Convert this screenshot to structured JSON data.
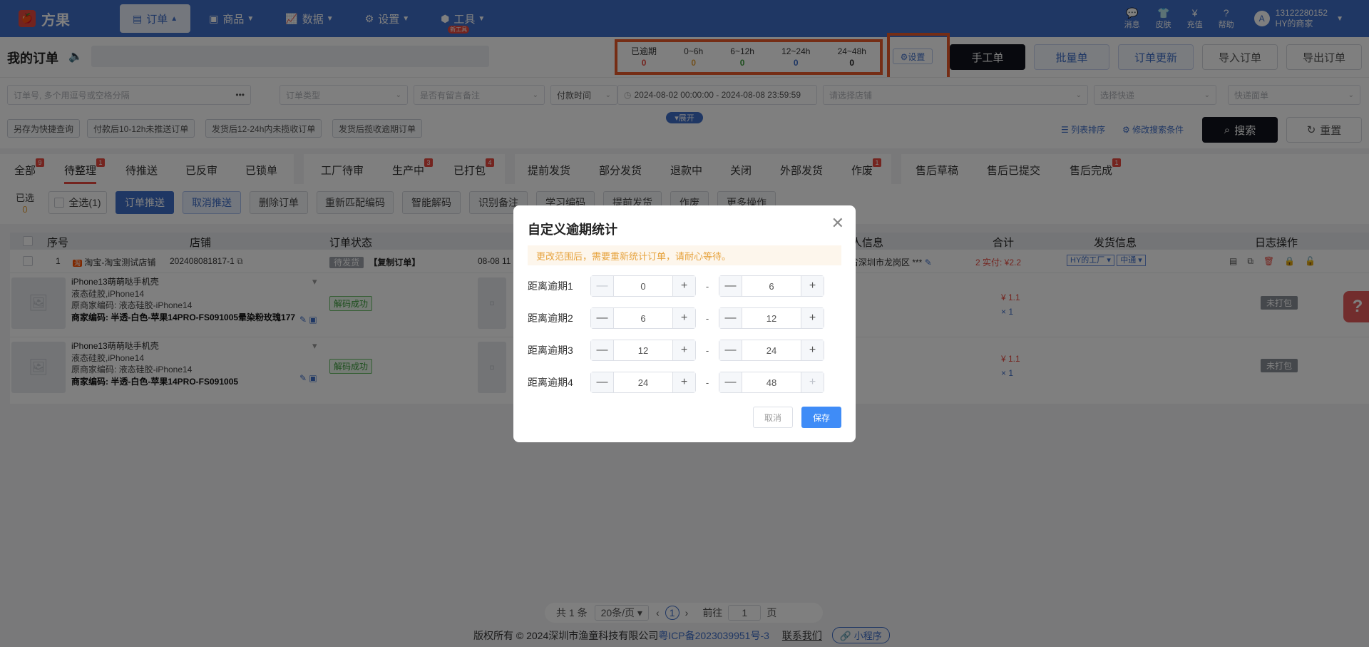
{
  "app": {
    "logo_glyph": "🍎",
    "name": "方果"
  },
  "nav": {
    "items": [
      {
        "label": "订单",
        "icon": "clipboard-icon",
        "glyph": "▤",
        "active": true,
        "caret": "▲"
      },
      {
        "label": "商品",
        "icon": "shop-icon",
        "glyph": "▣",
        "active": false,
        "caret": "▼"
      },
      {
        "label": "数据",
        "icon": "chart-icon",
        "glyph": "📈",
        "active": false,
        "caret": "▼"
      },
      {
        "label": "设置",
        "icon": "gear-icon",
        "glyph": "⚙",
        "active": false,
        "caret": "▼"
      },
      {
        "label": "工具",
        "icon": "box-icon",
        "glyph": "⬢",
        "active": false,
        "caret": "▼",
        "badge": "新工具"
      }
    ],
    "utils": [
      {
        "label": "消息",
        "glyph": "💬"
      },
      {
        "label": "皮肤",
        "glyph": "👕"
      },
      {
        "label": "充值",
        "glyph": "¥"
      },
      {
        "label": "帮助",
        "glyph": "?"
      }
    ],
    "user": {
      "avatar": "A",
      "phone": "13122280152",
      "shop": "HY的商家",
      "caret": "▼"
    }
  },
  "header": {
    "title": "我的订单",
    "speaker": "🔈",
    "overdue": [
      {
        "label": "已逾期",
        "value": "0",
        "color": "#e8493f"
      },
      {
        "label": "0~6h",
        "value": "0",
        "color": "#e6a23c"
      },
      {
        "label": "6~12h",
        "value": "0",
        "color": "#3a9d3a"
      },
      {
        "label": "12~24h",
        "value": "0",
        "color": "#3f6ec9"
      },
      {
        "label": "24~48h",
        "value": "0",
        "color": "#222222"
      }
    ],
    "settings_btn": "⚙设置",
    "buttons": {
      "manual": "手工单",
      "batch": "批量单",
      "update": "订单更新",
      "import": "导入订单",
      "export": "导出订单"
    }
  },
  "filters": {
    "order_no_placeholder": "订单号, 多个用逗号或空格分隔",
    "more": "•••",
    "order_type": "订单类型",
    "has_note": "是否有留言备注",
    "time_type": "付款时间",
    "date_range": "2024-08-02 00:00:00  -  2024-08-08 23:59:59",
    "shop": "请选择店铺",
    "express": "选择快递",
    "waybill": "快递面单",
    "quick": [
      "另存为快捷查询",
      "付款后10-12h未推送订单",
      "发货后12-24h内未揽收订单",
      "发货后揽收逾期订单"
    ],
    "expand": "▾展开",
    "sort_link": "列表排序",
    "edit_link": "修改搜索条件",
    "search": "搜索",
    "reset": "重置"
  },
  "tabs": [
    {
      "label": "全部",
      "badge": "9"
    },
    {
      "label": "待整理",
      "badge": "1",
      "active": true
    },
    {
      "label": "待推送"
    },
    {
      "label": "已反审"
    },
    {
      "label": "已锁单"
    },
    {
      "label": "工厂待审"
    },
    {
      "label": "生产中",
      "badge": "3"
    },
    {
      "label": "已打包",
      "badge": "4"
    },
    {
      "label": "提前发货"
    },
    {
      "label": "部分发货"
    },
    {
      "label": "退款中"
    },
    {
      "label": "关闭"
    },
    {
      "label": "外部发货"
    },
    {
      "label": "作废",
      "badge": "1"
    },
    {
      "label": "售后草稿"
    },
    {
      "label": "售后已提交"
    },
    {
      "label": "售后完成",
      "badge": "1"
    }
  ],
  "actions": {
    "selected_label": "已选",
    "selected_count": "0",
    "select_all": "全选(1)",
    "push": "订单推送",
    "cancel_push": "取消推送",
    "delete": "删除订单",
    "rematch": "重新匹配编码",
    "smart_decode": "智能解码",
    "identify_note": "识别备注",
    "learn_code": "学习编码",
    "early_ship": "提前发货",
    "void": "作废",
    "more": "更多操作"
  },
  "table": {
    "headers": {
      "no": "序号",
      "shop": "店铺",
      "status": "订单状态",
      "receiver": "人信息",
      "total": "合计",
      "ship": "发货信息",
      "log": "日志操作"
    },
    "order": {
      "index": "1",
      "shop": "淘宝-淘宝测试店铺",
      "order_no": "202408081817-1",
      "status": "待发货",
      "copy_tag": "【复制订单】",
      "time": "08-08 11",
      "address": "省深圳市龙岗区 ***",
      "total": "2 实付: ¥2.2",
      "factory": "HY的工厂 ▾",
      "express": "中通 ▾"
    },
    "items": [
      {
        "title": "iPhone13萌萌哒手机壳",
        "sub": "液态硅胶,iPhone14",
        "orig": "原商家编码: 液态硅胶-iPhone14",
        "code": "商家编码: 半透-白色-苹果14PRO-FS091005晕染粉玫瑰177",
        "decode": "解码成功",
        "price": "¥ 1.1",
        "qty": "× 1",
        "pack": "未打包"
      },
      {
        "title": "iPhone13萌萌哒手机壳",
        "sub": "液态硅胶,iPhone14",
        "orig": "原商家编码: 液态硅胶-iPhone14",
        "code": "商家编码: 半透-白色-苹果14PRO-FS091005",
        "decode": "解码成功",
        "price": "¥ 1.1",
        "qty": "× 1",
        "pack": "未打包"
      }
    ]
  },
  "pager": {
    "total": "共 1 条",
    "per_page": "20条/页 ▾",
    "prev": "‹",
    "page": "1",
    "next": "›",
    "goto": "前往",
    "goto_val": "1",
    "page_unit": "页"
  },
  "footer": {
    "copyright": "版权所有 © 2024深圳市渔童科技有限公司",
    "icp": "粤ICP备2023039951号-3",
    "contact": "联系我们",
    "mini": "🔗 小程序"
  },
  "help_float": "?",
  "modal": {
    "title": "自定义逾期统计",
    "close": "✕",
    "notice": "更改范围后，需要重新统计订单，请耐心等待。",
    "rows": [
      {
        "label": "距离逾期1",
        "from": "0",
        "to": "6"
      },
      {
        "label": "距离逾期2",
        "from": "6",
        "to": "12"
      },
      {
        "label": "距离逾期3",
        "from": "12",
        "to": "24"
      },
      {
        "label": "距离逾期4",
        "from": "24",
        "to": "48"
      }
    ],
    "minus": "—",
    "plus": "+",
    "dash": "-",
    "cancel": "取消",
    "save": "保存"
  }
}
